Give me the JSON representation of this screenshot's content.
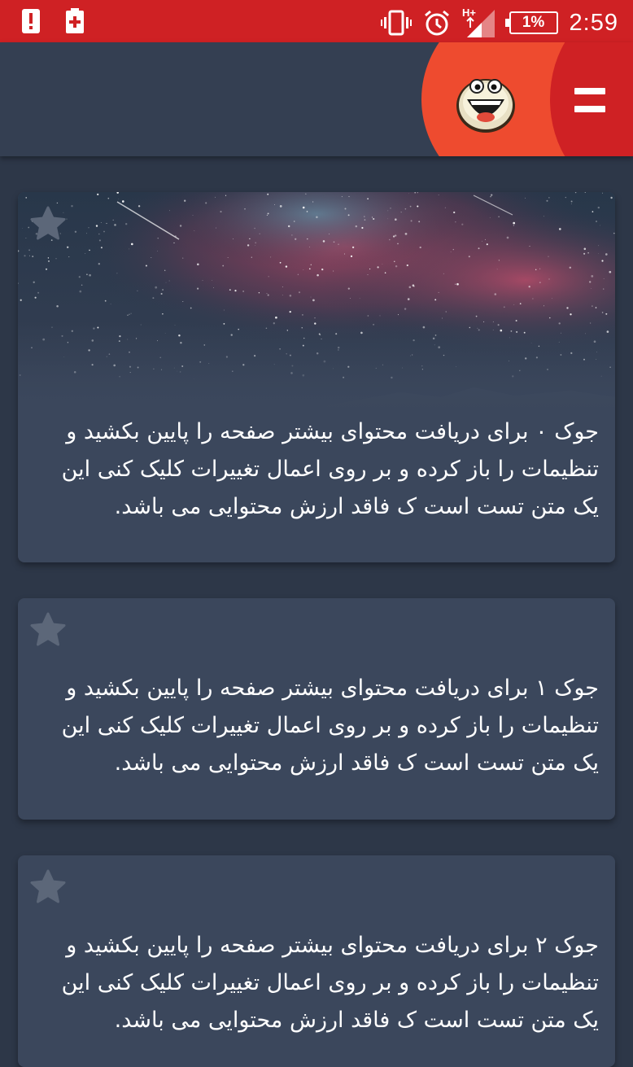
{
  "status_bar": {
    "time": "2:59",
    "battery": "1%",
    "network": "H+",
    "icons": [
      "alert-icon",
      "battery-saver-icon",
      "vibrate-icon",
      "alarm-icon",
      "signal-icon",
      "battery-icon"
    ]
  },
  "app_bar": {
    "logo_icon": "smiley-mascot-icon",
    "menu_icon": "hamburger-menu-icon",
    "brand_colors": {
      "primary": "#cf2124",
      "accent": "#ee4b2f",
      "background": "#343f52"
    }
  },
  "jokes": [
    {
      "text": "جوک ۰ برای دریافت محتوای بیشتر صفحه را پایین بکشید و تنظیمات را باز کرده و بر روی اعمال تغییرات کلیک کنی این یک متن تست است ک فاقد ارزش محتوایی می باشد.",
      "has_image": true,
      "favorite": false
    },
    {
      "text": "جوک ۱ برای دریافت محتوای بیشتر صفحه را پایین بکشید و تنظیمات را باز کرده و بر روی اعمال تغییرات کلیک کنی این یک متن تست است ک فاقد ارزش محتوایی می باشد.",
      "has_image": false,
      "favorite": false
    },
    {
      "text": "جوک ۲ برای دریافت محتوای بیشتر صفحه را پایین بکشید و تنظیمات را باز کرده و بر روی اعمال تغییرات کلیک کنی این یک متن تست است ک فاقد ارزش محتوایی می باشد.",
      "has_image": false,
      "favorite": false
    }
  ]
}
